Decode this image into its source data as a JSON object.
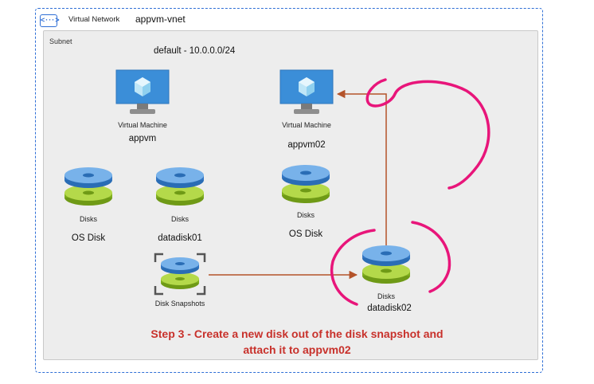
{
  "vnet": {
    "label": "Virtual Network",
    "name": "appvm-vnet"
  },
  "subnet": {
    "label": "Subnet",
    "range": "default - 10.0.0.0/24"
  },
  "vm1": {
    "type_label": "Virtual Machine",
    "name": "appvm"
  },
  "vm2": {
    "type_label": "Virtual Machine",
    "name": "appvm02"
  },
  "disks": [
    {
      "type_label": "Disks",
      "name": "OS Disk"
    },
    {
      "type_label": "Disks",
      "name": "datadisk01"
    },
    {
      "type_label": "Disks",
      "name": "OS Disk"
    },
    {
      "type_label": "Disks",
      "name": "datadisk02"
    }
  ],
  "snapshot": {
    "type_label": "Disk Snapshots"
  },
  "caption": {
    "line1": "Step 3 - Create a new disk out of the disk snapshot and",
    "line2": "attach it to appvm02"
  },
  "colors": {
    "accent": "#2f6fd6",
    "arrow": "#b4532a",
    "annotation": "#e8157a",
    "caption": "#c8312b"
  }
}
